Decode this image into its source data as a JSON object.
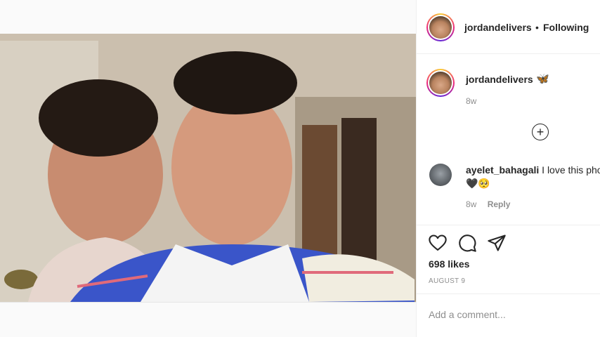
{
  "post": {
    "author": "jordandelivers",
    "follow_sep": "•",
    "follow_status": "Following"
  },
  "caption": {
    "author": "jordandelivers",
    "emoji": "🦋",
    "age": "8w"
  },
  "comment": {
    "author": "ayelet_bahagali",
    "text": "I love this photo",
    "emoji": "🖤🥺",
    "age": "8w",
    "reply_label": "Reply"
  },
  "load_more_icon": "plus-circle-icon",
  "actions": {
    "icons": [
      "heart-icon",
      "comment-icon",
      "share-icon"
    ],
    "likes": "698 likes",
    "date": "AUGUST 9"
  },
  "composer": {
    "placeholder": "Add a comment..."
  },
  "colors": {
    "text": "#262626",
    "muted": "#8e8e8e",
    "border": "#efefef"
  }
}
